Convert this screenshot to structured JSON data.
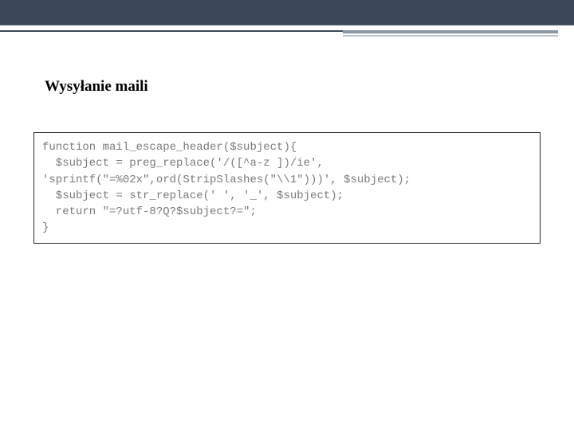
{
  "heading": "Wysyłanie maili",
  "code": {
    "line1": "function mail_escape_header($subject){",
    "line2": "  $subject = preg_replace('/([^a-z ])/ie',",
    "line3": "'sprintf(\"=%02x\",ord(StripSlashes(\"\\\\1\")))', $subject);",
    "line4": "  $subject = str_replace(' ', '_', $subject);",
    "line5": "  return \"=?utf-8?Q?$subject?=\";",
    "line6": "}"
  }
}
